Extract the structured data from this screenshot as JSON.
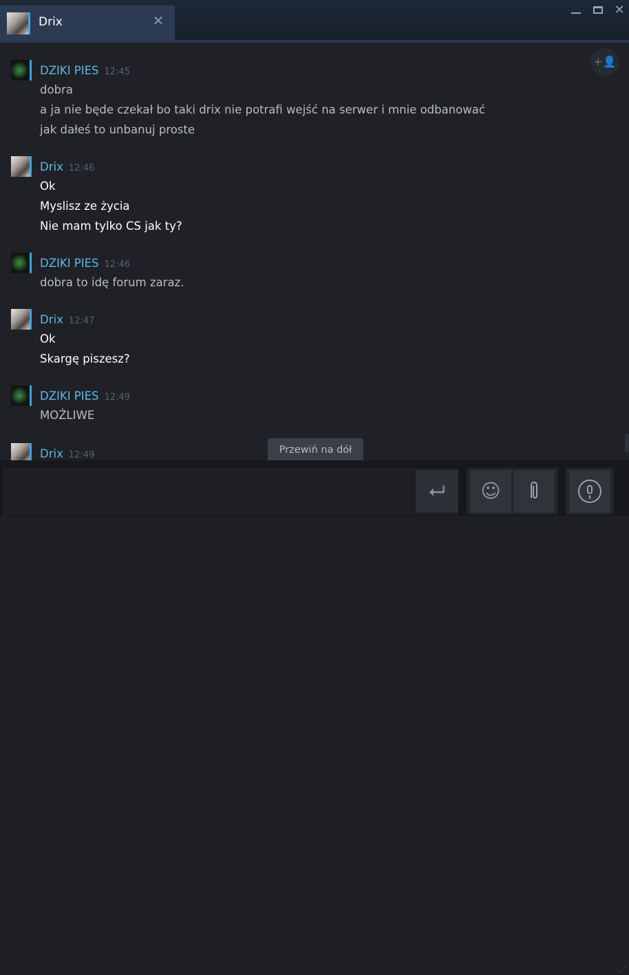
{
  "window": {
    "tab_name": "Drix",
    "tab_close": "✕",
    "close": "✕"
  },
  "chat": {
    "invite_icon": "+👤",
    "groups": [
      {
        "sender": "DZIKI PIES",
        "time": "12:45",
        "lines": [
          "dobra",
          "a ja nie będe czekał bo taki drix nie potrafi wejść na serwer i mnie odbanować",
          "jak dałeś to unbanuj proste"
        ]
      },
      {
        "sender": "Drix",
        "time": "12:46",
        "lines": [
          "Ok",
          "Myslisz ze życia",
          "Nie mam tylko CS jak ty?"
        ]
      },
      {
        "sender": "DZIKI PIES",
        "time": "12:46",
        "lines": [
          "dobra to idę forum zaraz."
        ]
      },
      {
        "sender": "Drix",
        "time": "12:47",
        "lines": [
          "Ok",
          "Skargę piszesz?"
        ]
      },
      {
        "sender": "DZIKI PIES",
        "time": "12:49",
        "lines": [
          "MOŻLIWE"
        ]
      },
      {
        "sender": "Drix",
        "time": "12:49",
        "lines": []
      }
    ],
    "scroll_to_bottom": "Przewiń na dół"
  },
  "composer": {
    "input_value": "",
    "send_icon": "⮠",
    "emoji_icon": "☺",
    "attach_icon": "📎"
  },
  "colors": {
    "accent": "#3ea6e6",
    "sender_name": "#5fb8e8",
    "tab_active": "#2c3b52"
  }
}
